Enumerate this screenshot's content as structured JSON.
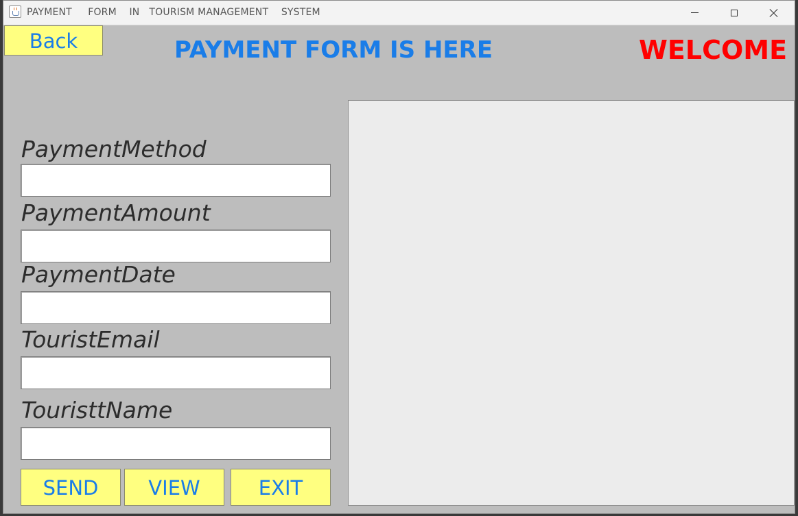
{
  "window": {
    "title": "PAYMENT     FORM    IN   TOURISM MANAGEMENT    SYSTEM",
    "icon": "java-cup-icon"
  },
  "header": {
    "back_label": "Back",
    "heading": "PAYMENT FORM IS HERE",
    "welcome": "WELCOME"
  },
  "form": {
    "fields": [
      {
        "label": "PaymentMethod",
        "value": ""
      },
      {
        "label": "PaymentAmount",
        "value": ""
      },
      {
        "label": "PaymentDate",
        "value": ""
      },
      {
        "label": "TouristEmail",
        "value": ""
      },
      {
        "label": "TouristtName",
        "value": ""
      }
    ]
  },
  "buttons": {
    "send": "SEND",
    "view": "VIEW",
    "exit": "EXIT"
  },
  "colors": {
    "background": "#bdbdbd",
    "button_fill": "#ffff80",
    "button_text": "#1a7de8",
    "heading": "#1a7de8",
    "welcome": "#ff0000",
    "panel": "#ececec"
  }
}
